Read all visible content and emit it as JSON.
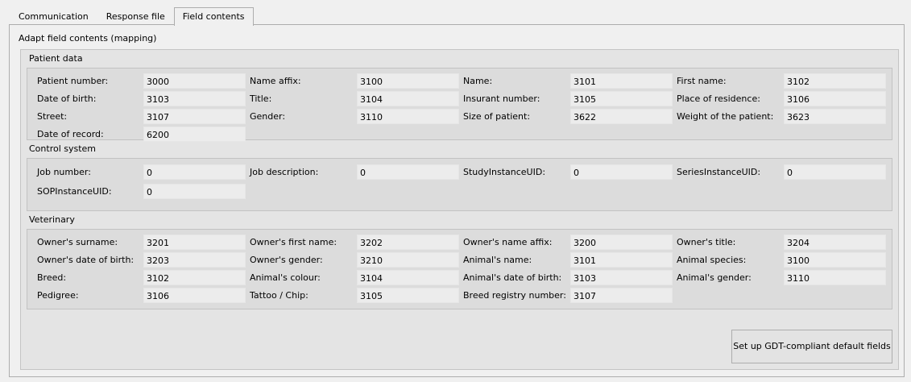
{
  "tabs": [
    {
      "label": "Communication",
      "active": false
    },
    {
      "label": "Response file",
      "active": false
    },
    {
      "label": "Field contents",
      "active": true
    }
  ],
  "panel_title": "Adapt field contents (mapping)",
  "sections": {
    "patient": {
      "title": "Patient data",
      "rows": [
        [
          [
            "Patient number:",
            "3000"
          ],
          [
            "Name affix:",
            "3100"
          ],
          [
            "Name:",
            "3101"
          ],
          [
            "First name:",
            "3102"
          ]
        ],
        [
          [
            "Date of birth:",
            "3103"
          ],
          [
            "Title:",
            "3104"
          ],
          [
            "Insurant number:",
            "3105"
          ],
          [
            "Place of residence:",
            "3106"
          ]
        ],
        [
          [
            "Street:",
            "3107"
          ],
          [
            "Gender:",
            "3110"
          ],
          [
            "Size of patient:",
            "3622"
          ],
          [
            "Weight of the patient:",
            "3623"
          ]
        ],
        [
          [
            "Date of record:",
            "6200"
          ]
        ]
      ]
    },
    "control": {
      "title": "Control system",
      "rows": [
        [
          [
            "Job number:",
            "0"
          ],
          [
            "Job description:",
            "0"
          ],
          [
            "StudyInstanceUID:",
            "0"
          ],
          [
            "SeriesInstanceUID:",
            "0"
          ]
        ],
        [
          [
            "SOPInstanceUID:",
            "0"
          ]
        ]
      ]
    },
    "vet": {
      "title": "Veterinary",
      "rows": [
        [
          [
            "Owner's surname:",
            "3201"
          ],
          [
            "Owner's first name:",
            "3202"
          ],
          [
            "Owner's name affix:",
            "3200"
          ],
          [
            "Owner's title:",
            "3204"
          ]
        ],
        [
          [
            "Owner's date of birth:",
            "3203"
          ],
          [
            "Owner's gender:",
            "3210"
          ],
          [
            "Animal's name:",
            "3101"
          ],
          [
            "Animal species:",
            "3100"
          ]
        ],
        [
          [
            "Breed:",
            "3102"
          ],
          [
            "Animal's colour:",
            "3104"
          ],
          [
            "Animal's date of birth:",
            "3103"
          ],
          [
            "Animal's gender:",
            "3110"
          ]
        ],
        [
          [
            "Pedigree:",
            "3106"
          ],
          [
            "Tattoo / Chip:",
            "3105"
          ],
          [
            "Breed registry number:",
            "3107"
          ]
        ]
      ]
    }
  },
  "default_button_label": "Set up GDT-compliant default fields"
}
